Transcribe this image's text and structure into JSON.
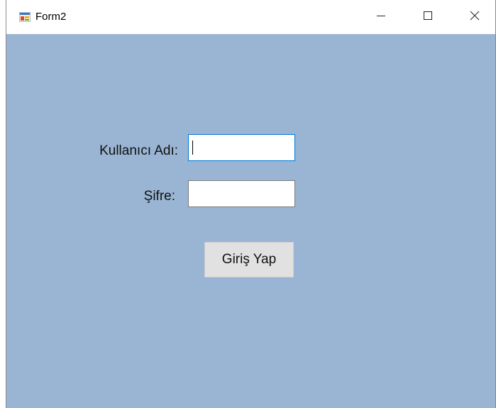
{
  "window": {
    "title": "Form2",
    "minimize_glyph": "—",
    "maximize_glyph": "☐",
    "close_glyph": "✕"
  },
  "form": {
    "username_label": "Kullanıcı Adı:",
    "username_value": "",
    "password_label": "Şifre:",
    "password_value": "",
    "login_button_label": "Giriş Yap"
  },
  "colors": {
    "client_background": "#9ab4d3",
    "button_face": "#e1e1e1",
    "focus_border": "#0078d7"
  },
  "icons": {
    "app": "windows-form-app-icon",
    "minimize": "minimize-icon",
    "maximize": "maximize-icon",
    "close": "close-icon"
  }
}
